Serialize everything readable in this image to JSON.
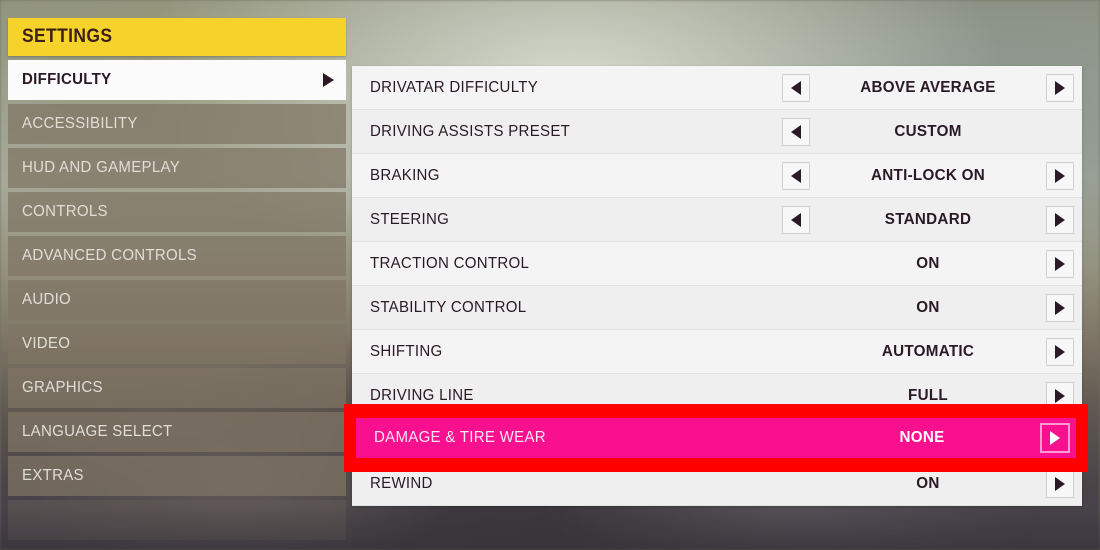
{
  "header": {
    "title": "SETTINGS"
  },
  "sidebar": {
    "items": [
      {
        "label": "DIFFICULTY",
        "active": true,
        "caret": "chevron-right-icon"
      },
      {
        "label": "ACCESSIBILITY",
        "active": false
      },
      {
        "label": "HUD AND GAMEPLAY",
        "active": false
      },
      {
        "label": "CONTROLS",
        "active": false
      },
      {
        "label": "ADVANCED CONTROLS",
        "active": false
      },
      {
        "label": "AUDIO",
        "active": false
      },
      {
        "label": "VIDEO",
        "active": false
      },
      {
        "label": "GRAPHICS",
        "active": false
      },
      {
        "label": "LANGUAGE SELECT",
        "active": false
      },
      {
        "label": "EXTRAS",
        "active": false
      }
    ]
  },
  "settings": {
    "rows": [
      {
        "name": "DRIVATAR DIFFICULTY",
        "value": "ABOVE AVERAGE",
        "left_arrow": true,
        "right_arrow": true
      },
      {
        "name": "DRIVING ASSISTS PRESET",
        "value": "CUSTOM",
        "left_arrow": true,
        "right_arrow": false
      },
      {
        "name": "BRAKING",
        "value": "ANTI-LOCK ON",
        "left_arrow": true,
        "right_arrow": true
      },
      {
        "name": "STEERING",
        "value": "STANDARD",
        "left_arrow": true,
        "right_arrow": true
      },
      {
        "name": "TRACTION CONTROL",
        "value": "ON",
        "left_arrow": false,
        "right_arrow": true
      },
      {
        "name": "STABILITY CONTROL",
        "value": "ON",
        "left_arrow": false,
        "right_arrow": true
      },
      {
        "name": "SHIFTING",
        "value": "AUTOMATIC",
        "left_arrow": false,
        "right_arrow": true
      },
      {
        "name": "DRIVING LINE",
        "value": "FULL",
        "left_arrow": false,
        "right_arrow": true
      },
      {
        "name": "DAMAGE & TIRE WEAR",
        "value": "NONE",
        "left_arrow": false,
        "right_arrow": true
      },
      {
        "name": "REWIND",
        "value": "ON",
        "left_arrow": false,
        "right_arrow": true
      }
    ]
  },
  "highlight": {
    "row_name": "DAMAGE & TIRE WEAR",
    "row_value": "NONE",
    "outline_color": "#ff0000",
    "fill_color": "#f8108f",
    "arrow_icon": "chevron-right-icon"
  },
  "colors": {
    "header_yellow": "#f5d32a",
    "header_text": "#3c2018",
    "panel_bg": "#f2f2f2",
    "text_dark": "#2b1a26",
    "nav_bg": "rgba(128,117,100,.72)"
  }
}
